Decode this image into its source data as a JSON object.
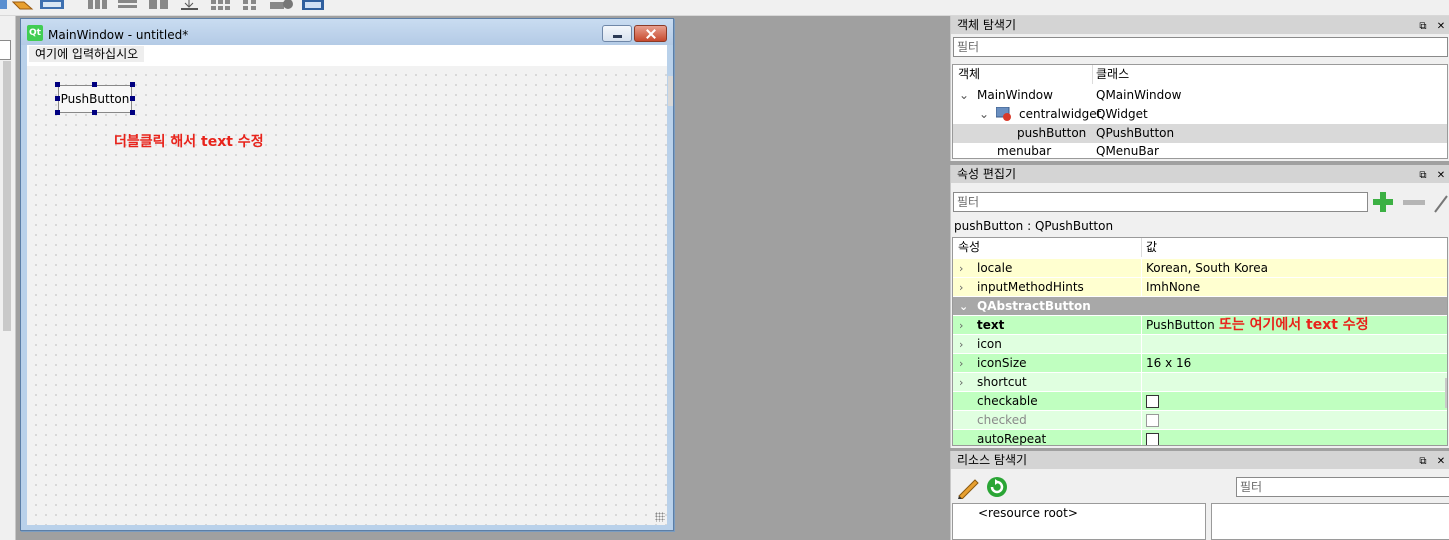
{
  "designer": {
    "window_title": "MainWindow - untitled*",
    "logo_text": "Qt",
    "menu_placeholder": "여기에 입력하십시오",
    "push_button_label": "PushButton",
    "annotation_canvas": "더블클릭 해서 text 수정"
  },
  "object_inspector": {
    "title": "객체 탐색기",
    "filter_placeholder": "필터",
    "header": {
      "object": "객체",
      "class": "클래스"
    },
    "rows": [
      {
        "object": "MainWindow",
        "class": "QMainWindow"
      },
      {
        "object": "centralwidget",
        "class": "QWidget"
      },
      {
        "object": "pushButton",
        "class": "QPushButton"
      },
      {
        "object": "menubar",
        "class": "QMenuBar"
      }
    ]
  },
  "property_editor": {
    "title": "속성 편집기",
    "filter_placeholder": "필터",
    "selected_object": "pushButton : QPushButton",
    "header": {
      "property": "속성",
      "value": "값"
    },
    "rows": [
      {
        "name": "locale",
        "value": "Korean, South Korea"
      },
      {
        "name": "inputMethodHints",
        "value": "ImhNone"
      },
      {
        "name": "QAbstractButton",
        "value": ""
      },
      {
        "name": "text",
        "value": "PushButton"
      },
      {
        "name": "icon",
        "value": ""
      },
      {
        "name": "iconSize",
        "value": "16 x 16"
      },
      {
        "name": "shortcut",
        "value": ""
      },
      {
        "name": "checkable",
        "value": ""
      },
      {
        "name": "checked",
        "value": ""
      },
      {
        "name": "autoRepeat",
        "value": ""
      }
    ],
    "annotation_text_row": "또는 여기에서 text 수정"
  },
  "resource_browser": {
    "title": "리소스 탐색기",
    "filter_placeholder": "필터",
    "root_label": "<resource root>"
  },
  "colors": {
    "annotation": "#e8231b",
    "prop_yellow": "#ffffd0",
    "prop_green": "#c0ffc0",
    "prop_green_light": "#e0ffe0",
    "group_header": "#a8a8a8",
    "selection": "#d9d9d9"
  }
}
